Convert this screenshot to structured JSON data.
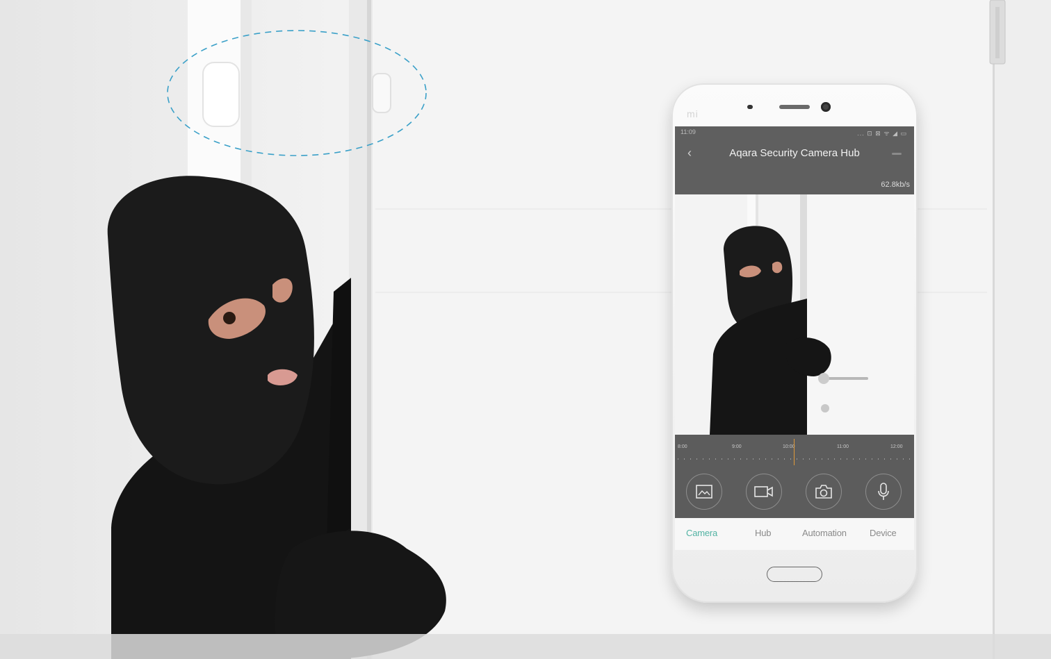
{
  "phone": {
    "brand_logo": "mi",
    "status_time": "11:09",
    "status_icons": "... ⊡ ⊠ ᯤ ◢ ▭",
    "app_title": "Aqara Security Camera Hub",
    "data_rate": "62.8kb/s",
    "timeline_labels": [
      "8:00",
      "9:00",
      "10:00",
      "11:00",
      "12:00"
    ],
    "controls": [
      {
        "name": "gallery",
        "icon": "image-icon"
      },
      {
        "name": "record",
        "icon": "video-camera-icon"
      },
      {
        "name": "snapshot",
        "icon": "camera-icon"
      },
      {
        "name": "talk",
        "icon": "microphone-icon"
      }
    ],
    "tabs": [
      {
        "label": "Camera",
        "active": true
      },
      {
        "label": "Hub",
        "active": false
      },
      {
        "label": "Automation",
        "active": false
      },
      {
        "label": "Device",
        "active": false
      }
    ]
  },
  "colors": {
    "accent": "#52b3a3",
    "highlight_ring": "#3aa0c8",
    "playhead": "#e09a3a"
  }
}
